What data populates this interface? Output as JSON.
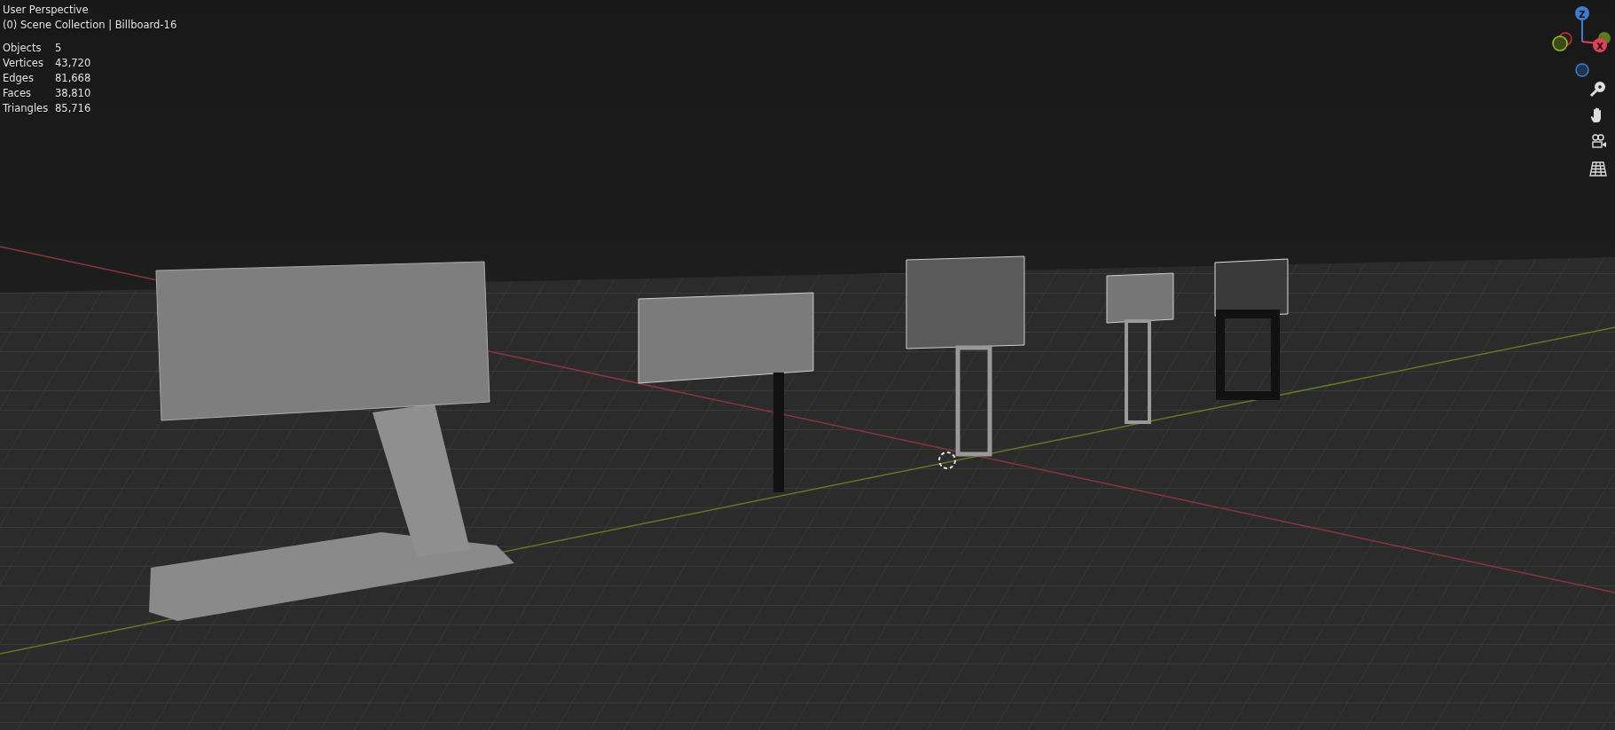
{
  "viewport": {
    "view_name": "User Perspective",
    "context": "(0) Scene Collection | Billboard-16"
  },
  "stats": [
    {
      "label": "Objects",
      "value": "5"
    },
    {
      "label": "Vertices",
      "value": "43,720"
    },
    {
      "label": "Edges",
      "value": "81,668"
    },
    {
      "label": "Faces",
      "value": "38,810"
    },
    {
      "label": "Triangles",
      "value": "85,716"
    }
  ],
  "gizmo": {
    "z_label": "Z",
    "x_label": "X"
  }
}
